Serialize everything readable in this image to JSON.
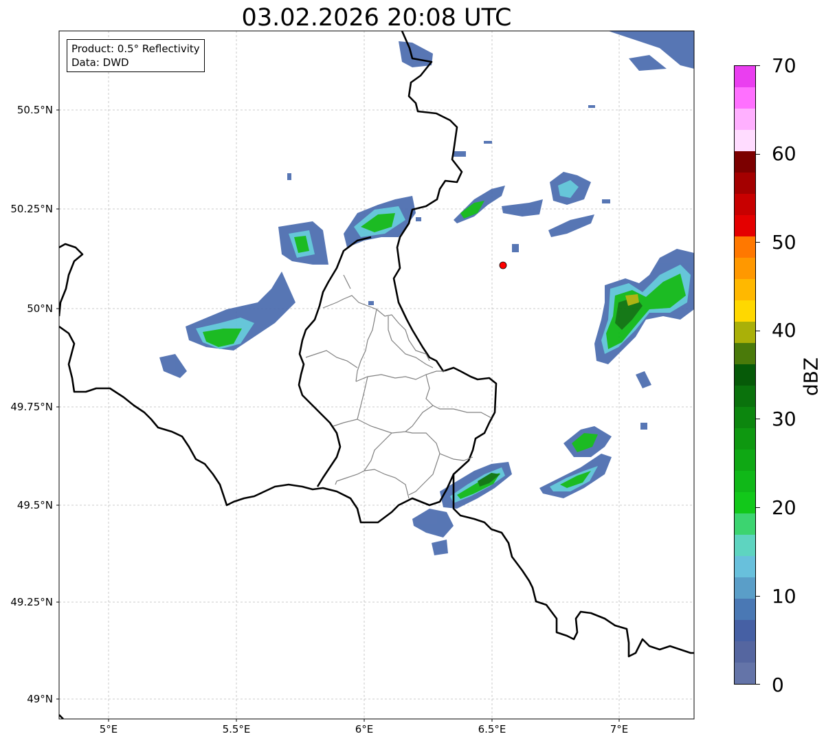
{
  "title": "03.02.2026 20:08 UTC",
  "info_box": {
    "product": "Product: 0.5° Reflectivity",
    "source": "Data: DWD"
  },
  "lat_labels": [
    "50.5°N",
    "50.25°N",
    "50°N",
    "49.75°N",
    "49.5°N",
    "49.25°N",
    "49°N"
  ],
  "lon_labels": [
    "5°E",
    "5.5°E",
    "6°E",
    "6.5°E",
    "7°E"
  ],
  "colorbar": {
    "unit": "dBZ",
    "ticks": [
      "0",
      "10",
      "20",
      "30",
      "40",
      "50",
      "60",
      "70"
    ],
    "colors": [
      "#6474a8",
      "#5566a0",
      "#4660a4",
      "#4a78b4",
      "#5a9ec8",
      "#68c0dc",
      "#5ed4c0",
      "#3cd470",
      "#12c81a",
      "#10b818",
      "#0fa814",
      "#0e9810",
      "#0c860e",
      "#0a720c",
      "#065a08",
      "#4a7a0a",
      "#aab008",
      "#ffd800",
      "#ffb800",
      "#ff9800",
      "#ff7800",
      "#e40000",
      "#c80000",
      "#a40000",
      "#7c0000",
      "#ffdcff",
      "#ffb0ff",
      "#ff70ff",
      "#ea3ef0"
    ]
  },
  "colors": {
    "border": "#000000",
    "canton_lines": "#808080",
    "grid": "#bbbbbb",
    "radar_site": "#ff0000",
    "echo_low": "#4f6fb0",
    "echo_mid": "#5ec4d8",
    "echo_green": "#10b818",
    "echo_dark": "#0a720c",
    "echo_yellow": "#aab008"
  }
}
